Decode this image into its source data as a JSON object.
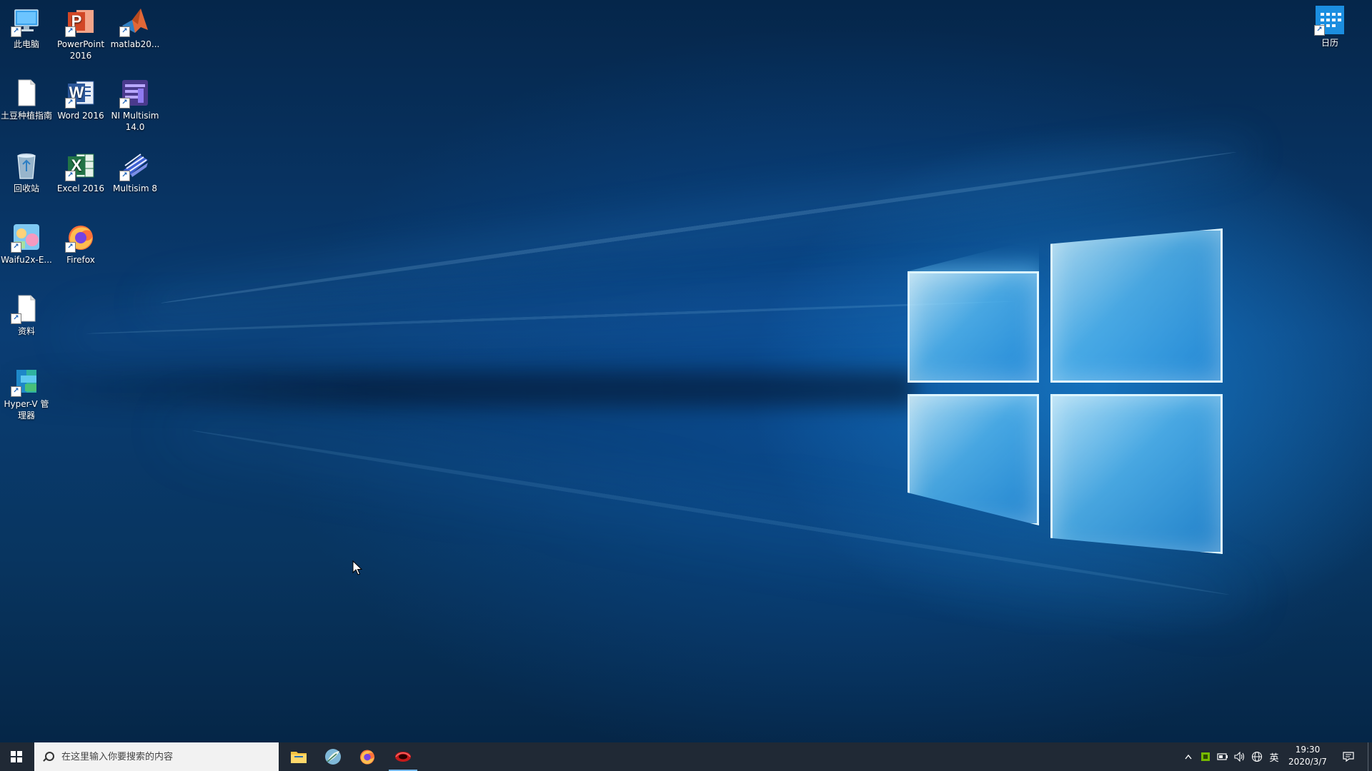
{
  "desktop": {
    "icons": [
      {
        "label": "此电脑",
        "icon": "computer-icon"
      },
      {
        "label": "PowerPoint 2016",
        "icon": "powerpoint-icon"
      },
      {
        "label": "matlab20...",
        "icon": "matlab-icon"
      },
      {
        "label": "土豆种植指南",
        "icon": "document-icon"
      },
      {
        "label": "Word 2016",
        "icon": "word-icon"
      },
      {
        "label": "NI Multisim 14.0",
        "icon": "multisim-icon"
      },
      {
        "label": "回收站",
        "icon": "recycle-bin-icon"
      },
      {
        "label": "Excel 2016",
        "icon": "excel-icon"
      },
      {
        "label": "Multisim 8",
        "icon": "multisim8-icon"
      },
      {
        "label": "Waifu2x-E...",
        "icon": "waifu2x-icon"
      },
      {
        "label": "Firefox",
        "icon": "firefox-icon"
      },
      {
        "label": "资料",
        "icon": "file-icon"
      },
      {
        "label": "Hyper-V 管理器",
        "icon": "hyperv-icon"
      }
    ],
    "calendar_icon": {
      "label": "日历",
      "icon": "calendar-icon"
    },
    "glyphs": {
      "powerpoint": "P",
      "word": "W",
      "excel": "X",
      "shortcut": "↗"
    }
  },
  "taskbar": {
    "search_placeholder": "在这里输入你要搜索的内容",
    "pinned": [
      {
        "name": "file-explorer",
        "icon": "folder-icon"
      },
      {
        "name": "app-feather",
        "icon": "feather-app-icon"
      },
      {
        "name": "firefox",
        "icon": "firefox-icon"
      },
      {
        "name": "recorder",
        "icon": "recorder-app-icon",
        "active": true
      }
    ],
    "tray": {
      "chevron": "^",
      "ime": "英",
      "time": "19:30",
      "date": "2020/3/7"
    }
  },
  "colors": {
    "taskbar_bg": "#121c28",
    "accent": "#76b9ed",
    "wallpaper_dark": "#05264a",
    "wallpaper_light": "#2a9ef0"
  }
}
